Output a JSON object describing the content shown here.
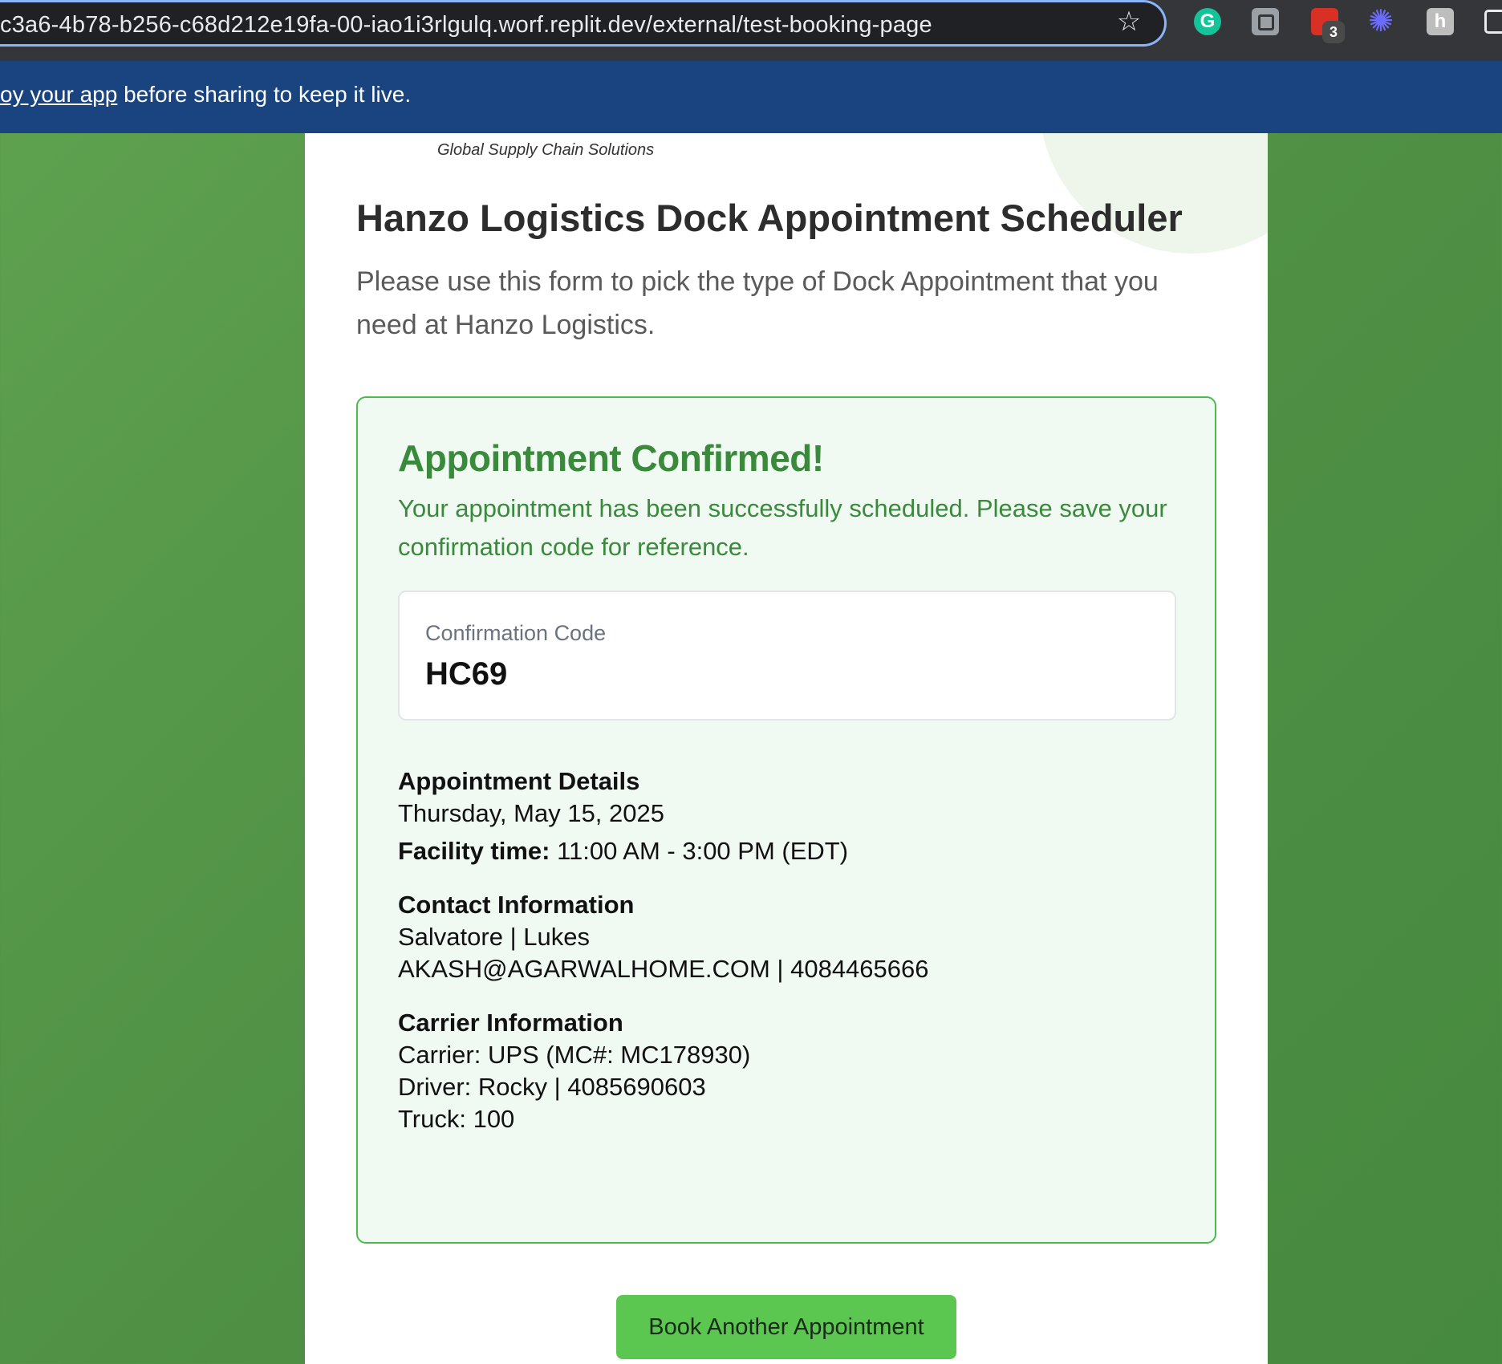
{
  "browser": {
    "url": "c3a6-4b78-b256-c68d212e19fa-00-iao1i3rlgulq.worf.replit.dev/external/test-booking-page",
    "extension_badge_count": "3"
  },
  "banner": {
    "link_text": "oy your app",
    "text": " before sharing to keep it live."
  },
  "header": {
    "tagline": "Global Supply Chain Solutions"
  },
  "page": {
    "title": "Hanzo Logistics Dock Appointment Scheduler",
    "intro": "Please use this form to pick the type of Dock Appointment that you need at Hanzo Logistics."
  },
  "confirmation": {
    "title": "Appointment Confirmed!",
    "message": "Your appointment has been successfully scheduled. Please save your confirmation code for reference.",
    "code_label": "Confirmation Code",
    "code": "HC69"
  },
  "details": {
    "heading": "Appointment Details",
    "date": "Thursday, May 15, 2025",
    "facility_time_label": "Facility time:",
    "facility_time_value": " 11:00 AM - 3:00 PM (EDT)"
  },
  "contact": {
    "heading": "Contact Information",
    "name": "Salvatore | Lukes",
    "email_phone": "AKASH@AGARWALHOME.COM | 4084465666"
  },
  "carrier": {
    "heading": "Carrier Information",
    "carrier": "Carrier: UPS (MC#: MC178930)",
    "driver": "Driver: Rocky | 4085690603",
    "truck": "Truck: 100"
  },
  "actions": {
    "book_another": "Book Another Appointment"
  },
  "colors": {
    "background_green": "#4e8f44",
    "banner_blue": "#1a4480",
    "confirm_green": "#3a8a3c",
    "button_green": "#5bc751"
  },
  "icons": {
    "star": "star-icon",
    "extensions": [
      "grammarly-icon",
      "extension-box-icon",
      "extension-red-icon",
      "burst-icon",
      "h-extension-icon",
      "puzzle-icon"
    ]
  }
}
